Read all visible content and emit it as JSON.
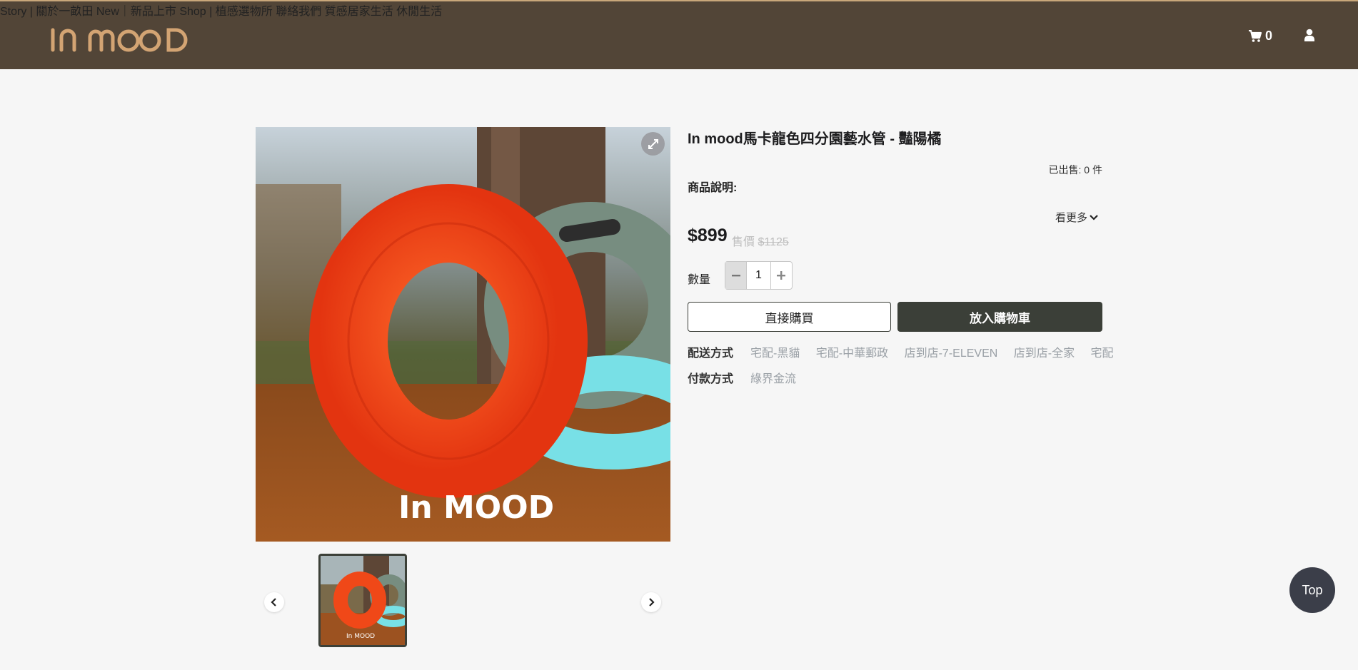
{
  "header": {
    "logo_text": "In MOOD",
    "nav": [
      "Story | 關於一畝田",
      "New｜新品上市",
      "Shop | 植感選物所",
      "聯絡我們",
      "質感居家生活",
      "休閒生活"
    ],
    "cart_count": "0",
    "colors": {
      "bar": "#524537",
      "accent": "#d3a473"
    }
  },
  "gallery": {
    "watermark": "In MOOD",
    "thumb_watermark": "In MOOD"
  },
  "product": {
    "title": "In mood馬卡龍色四分園藝水管 - 豔陽橘",
    "sold_label": "已出售: 0 件",
    "desc_label": "商品說明:",
    "more_label": "看更多",
    "price": "$899",
    "orig_label": "售價",
    "orig_price": "$1125",
    "qty_label": "數量",
    "qty_value": "1",
    "buy_now": "直接購買",
    "add_cart": "放入購物車",
    "shipping_label": "配送方式",
    "shipping_options": [
      "宅配-黑貓",
      "宅配-中華郵政",
      "店到店-7-ELEVEN",
      "店到店-全家",
      "宅配"
    ],
    "payment_label": "付款方式",
    "payment_options": [
      "綠界金流"
    ]
  },
  "top_button": "Top"
}
